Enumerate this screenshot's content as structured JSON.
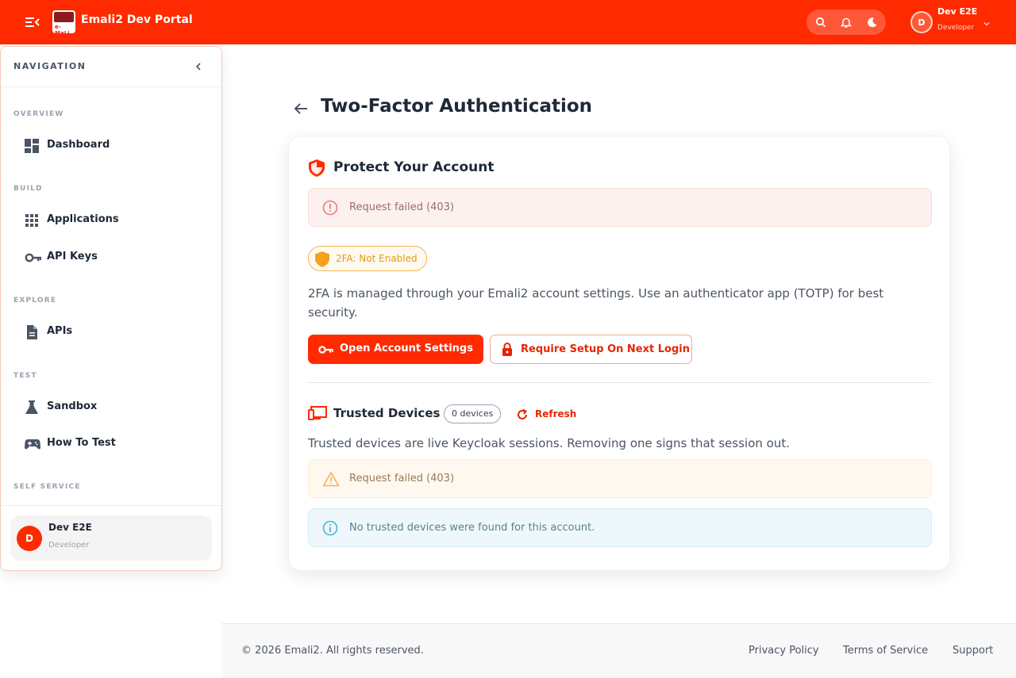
{
  "app": {
    "title": "Emali2 Dev Portal",
    "accent": "#ff2a00"
  },
  "header": {
    "user": {
      "initial": "D",
      "name": "Dev E2E",
      "role": "Developer"
    },
    "icons": [
      "menu-collapse-icon",
      "search-icon",
      "bell-icon",
      "moon-icon",
      "chevron-down-icon"
    ]
  },
  "sidebar": {
    "title": "NAVIGATION",
    "sections": {
      "overview": "OVERVIEW",
      "build": "BUILD",
      "explore": "EXPLORE",
      "test": "TEST",
      "self_service": "SELF SERVICE"
    },
    "items": [
      {
        "label": "Dashboard",
        "icon": "dashboard-icon"
      },
      {
        "label": "Applications",
        "icon": "apps-grid-icon"
      },
      {
        "label": "API Keys",
        "icon": "key-icon"
      },
      {
        "label": "APIs",
        "icon": "document-icon"
      },
      {
        "label": "Sandbox",
        "icon": "flask-icon"
      },
      {
        "label": "How To Test",
        "icon": "gamepad-icon"
      }
    ],
    "user": {
      "initial": "D",
      "name": "Dev E2E",
      "role": "Developer"
    }
  },
  "page": {
    "title": "Two-Factor Authentication",
    "card": {
      "title": "Protect Your Account",
      "error_alert": "Request failed (403)",
      "status_badge": "2FA: Not Enabled",
      "description": "2FA is managed through your Emali2 account settings. Use an authenticator app (TOTP) for best security.",
      "primary_button": "Open Account Settings",
      "secondary_button": "Require Setup On Next Login",
      "trusted_devices": {
        "title": "Trusted Devices",
        "count_badge": "0 devices",
        "refresh_label": "Refresh",
        "description": "Trusted devices are live Keycloak sessions. Removing one signs that session out.",
        "warning_alert": "Request failed (403)",
        "info_alert": "No trusted devices were found for this account."
      }
    }
  },
  "footer": {
    "copyright": "© 2026 Emali2. All rights reserved.",
    "links": [
      "Privacy Policy",
      "Terms of Service",
      "Support"
    ]
  }
}
